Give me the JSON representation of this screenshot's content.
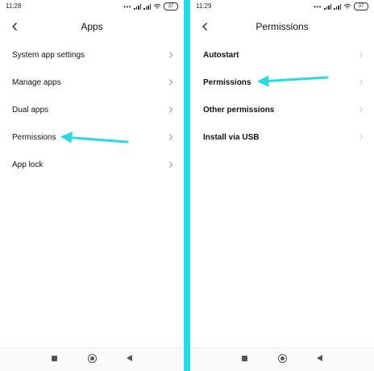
{
  "colors": {
    "accent": "#2bd9e0",
    "text": "#111111",
    "chevron_enabled": "#9a9a9a",
    "chevron_disabled": "#cfcfcf",
    "background": "#ffffff"
  },
  "left_screen": {
    "status_time": "11:28",
    "battery": "37",
    "title": "Apps",
    "back_icon": "chevron-left-icon",
    "items": [
      {
        "label": "System app settings"
      },
      {
        "label": "Manage apps"
      },
      {
        "label": "Dual apps"
      },
      {
        "label": "Permissions"
      },
      {
        "label": "App lock"
      }
    ]
  },
  "right_screen": {
    "status_time": "11:29",
    "battery": "37",
    "title": "Permissions",
    "back_icon": "chevron-left-icon",
    "items": [
      {
        "label": "Autostart"
      },
      {
        "label": "Permissions"
      },
      {
        "label": "Other permissions"
      },
      {
        "label": "Install via USB"
      }
    ]
  },
  "nav_bar": {
    "icons": [
      "recents-square-icon",
      "home-circle-icon",
      "back-triangle-icon"
    ]
  }
}
